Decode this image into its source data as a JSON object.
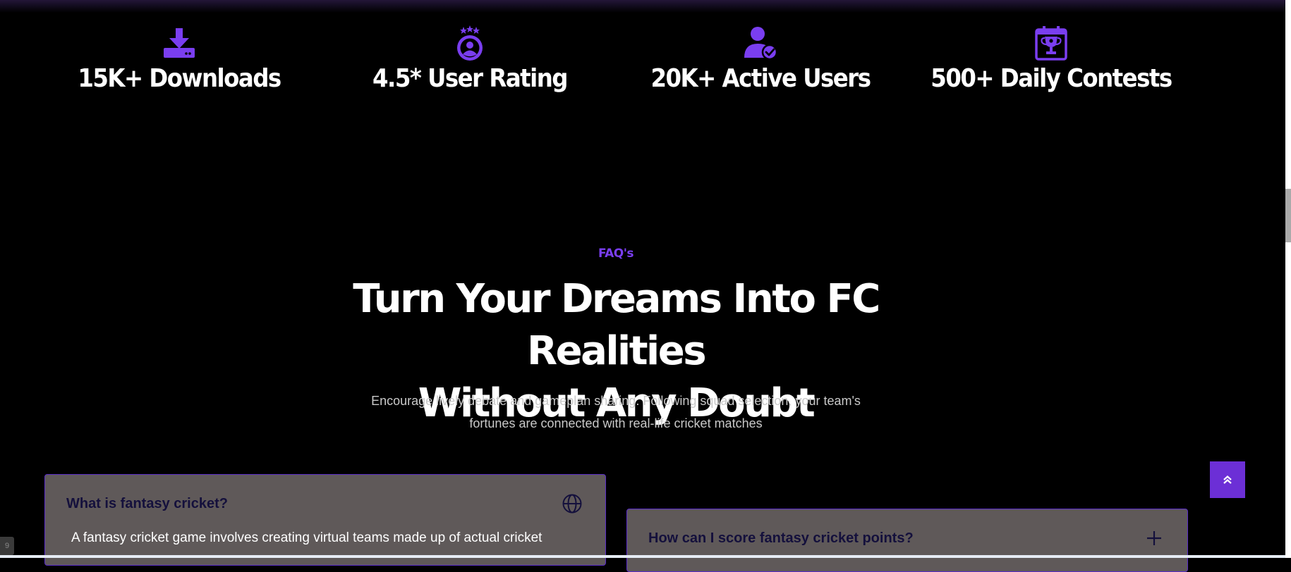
{
  "stats": [
    {
      "icon": "download-icon",
      "label": "15K+ Downloads"
    },
    {
      "icon": "user-rating-icon",
      "label": "4.5* User Rating"
    },
    {
      "icon": "verified-user-icon",
      "label": "20K+ Active Users"
    },
    {
      "icon": "trophy-calendar-icon",
      "label": "500+ Daily Contests"
    }
  ],
  "faq_section": {
    "eyebrow": "FAQ's",
    "title_line1": "Turn Your Dreams Into FC Realities",
    "title_line2": "Without Any Doubt",
    "subtitle_line1": "Encourage lively debate and gameplan sharing. Following squad selection, your team's",
    "subtitle_line2": "fortunes are connected with real-life cricket matches",
    "items": [
      {
        "question": "What is fantasy cricket?",
        "answer": "A fantasy cricket game involves creating virtual teams made up of actual cricket",
        "toggle_icon": "globe-icon",
        "expanded": true
      },
      {
        "question": "How can I score fantasy cricket points?",
        "toggle_icon": "plus-icon",
        "expanded": false
      }
    ]
  },
  "corner_badge": "9",
  "colors": {
    "accent": "#7a3ef0",
    "card_bg": "#5f5959",
    "question_text": "#14103c",
    "background": "#000000"
  }
}
